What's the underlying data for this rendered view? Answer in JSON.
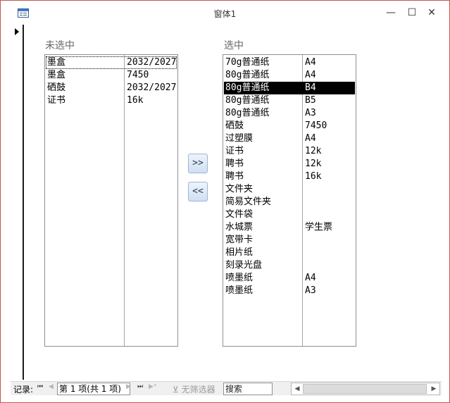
{
  "window": {
    "title": "窗体1",
    "minimize_glyph": "—",
    "maximize_glyph": "☐",
    "close_glyph": "✕"
  },
  "form": {
    "left_caption": "未选中",
    "right_caption": "选中",
    "move_right_label": ">>",
    "move_left_label": "<<",
    "unselected_list": [
      [
        "墨盒",
        "2032/2027"
      ],
      [
        "墨盒",
        "7450"
      ],
      [
        "硒鼓",
        "2032/2027"
      ],
      [
        "证书",
        "16k"
      ]
    ],
    "selected_list": [
      [
        "70g普通纸",
        "A4"
      ],
      [
        "80g普通纸",
        "A4"
      ],
      [
        "80g普通纸",
        "B4"
      ],
      [
        "80g普通纸",
        "B5"
      ],
      [
        "80g普通纸",
        "A3"
      ],
      [
        "硒鼓",
        "7450"
      ],
      [
        "过塑膜",
        "A4"
      ],
      [
        "证书",
        "12k"
      ],
      [
        "聘书",
        "12k"
      ],
      [
        "聘书",
        "16k"
      ],
      [
        "文件夹",
        ""
      ],
      [
        "简易文件夹",
        ""
      ],
      [
        "文件袋",
        ""
      ],
      [
        "水城票",
        "学生票"
      ],
      [
        "宽带卡",
        ""
      ],
      [
        "相片纸",
        ""
      ],
      [
        "刻录光盘",
        ""
      ],
      [
        "喷墨纸",
        "A4"
      ],
      [
        "喷墨纸",
        "A3"
      ]
    ],
    "selected_index": 2
  },
  "navbar": {
    "record_label": "记录:",
    "first_glyph": "⏮",
    "prev_glyph": "◀",
    "current_record": "第 1 项(共 1 项)",
    "next_glyph": "▶",
    "last_glyph": "⏭",
    "new_glyph": "▶*",
    "filter_label": "无筛选器",
    "search_label": "搜索",
    "scroll_left_glyph": "◀",
    "scroll_right_glyph": "▶"
  }
}
